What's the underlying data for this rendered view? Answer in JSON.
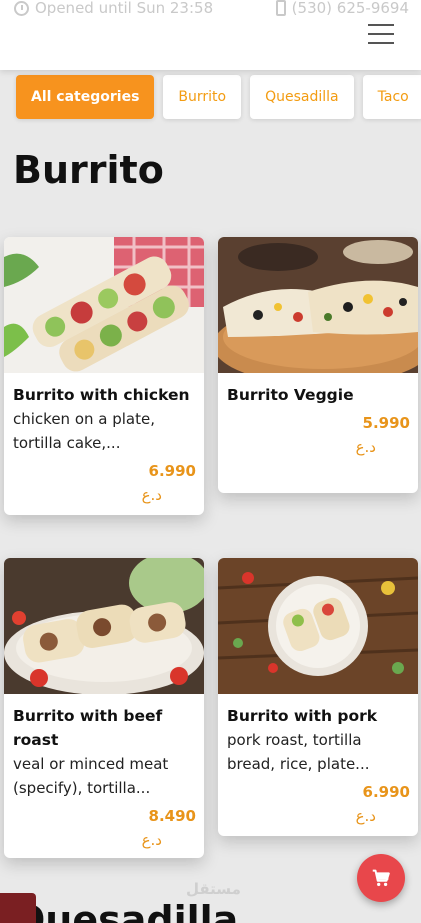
{
  "header": {
    "opening_hours": "Opened until Sun 23:58",
    "phone": "(530) 625-9694",
    "menu_icon": "hamburger-menu-icon"
  },
  "category_tabs": [
    {
      "label": "All categories",
      "active": true
    },
    {
      "label": "Burrito",
      "active": false
    },
    {
      "label": "Quesadilla",
      "active": false
    },
    {
      "label": "Taco",
      "active": false
    }
  ],
  "sections": [
    {
      "title": "Burrito",
      "items": [
        {
          "name": "Burrito with chicken",
          "description": "chicken on a plate, tortilla cake,...",
          "price": "6.990",
          "currency": "د.ع"
        },
        {
          "name": "Burrito Veggie",
          "description": "",
          "price": "5.990",
          "currency": "د.ع"
        },
        {
          "name": "Burrito with beef roast",
          "description": "veal or minced meat (specify), tortilla...",
          "price": "8.490",
          "currency": "د.ع"
        },
        {
          "name": "Burrito with pork",
          "description": "pork roast, tortilla bread, rice, plate...",
          "price": "6.990",
          "currency": "د.ع"
        }
      ]
    },
    {
      "title": "Quesadilla"
    }
  ],
  "cart_button": {
    "icon": "shopping-cart-icon"
  },
  "watermark": "مستقل",
  "colors": {
    "accent": "#f7931e",
    "price": "#e8941a",
    "cart": "#e8474b"
  }
}
